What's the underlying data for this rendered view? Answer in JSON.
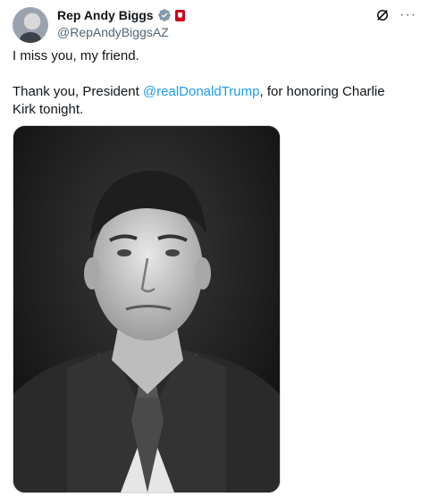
{
  "author": {
    "display_name": "Rep Andy Biggs",
    "handle": "@RepAndyBiggsAZ",
    "verified_icon": "verified-badge-icon",
    "affiliation_icon": "government-flag-icon"
  },
  "actions": {
    "grok_icon": "grok-icon",
    "more_label": "···"
  },
  "post": {
    "line1": "I miss you, my friend.",
    "line2_before": "Thank you, President ",
    "mention": "@realDonaldTrump",
    "line2_after": ", for honoring Charlie Kirk tonight."
  },
  "media": {
    "type": "black-and-white photo"
  },
  "colors": {
    "accent": "#1d9bf0",
    "verified": "#829aab",
    "flag": "#d0021b"
  }
}
